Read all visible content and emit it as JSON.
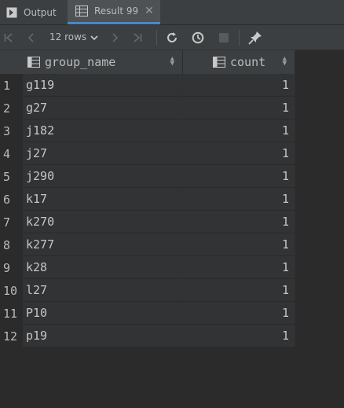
{
  "tabs": {
    "output_label": "Output",
    "result_label": "Result 99"
  },
  "toolbar": {
    "rows_label": "12 rows"
  },
  "table": {
    "columns": [
      "group_name",
      "count"
    ],
    "rows": [
      {
        "num": "1",
        "group_name": "g119",
        "count": "1"
      },
      {
        "num": "2",
        "group_name": "g27",
        "count": "1"
      },
      {
        "num": "3",
        "group_name": "j182",
        "count": "1"
      },
      {
        "num": "4",
        "group_name": "j27",
        "count": "1"
      },
      {
        "num": "5",
        "group_name": "j290",
        "count": "1"
      },
      {
        "num": "6",
        "group_name": "k17",
        "count": "1"
      },
      {
        "num": "7",
        "group_name": "k270",
        "count": "1"
      },
      {
        "num": "8",
        "group_name": "k277",
        "count": "1"
      },
      {
        "num": "9",
        "group_name": "k28",
        "count": "1"
      },
      {
        "num": "10",
        "group_name": "l27",
        "count": "1"
      },
      {
        "num": "11",
        "group_name": "P10",
        "count": "1"
      },
      {
        "num": "12",
        "group_name": "p19",
        "count": "1"
      }
    ]
  }
}
